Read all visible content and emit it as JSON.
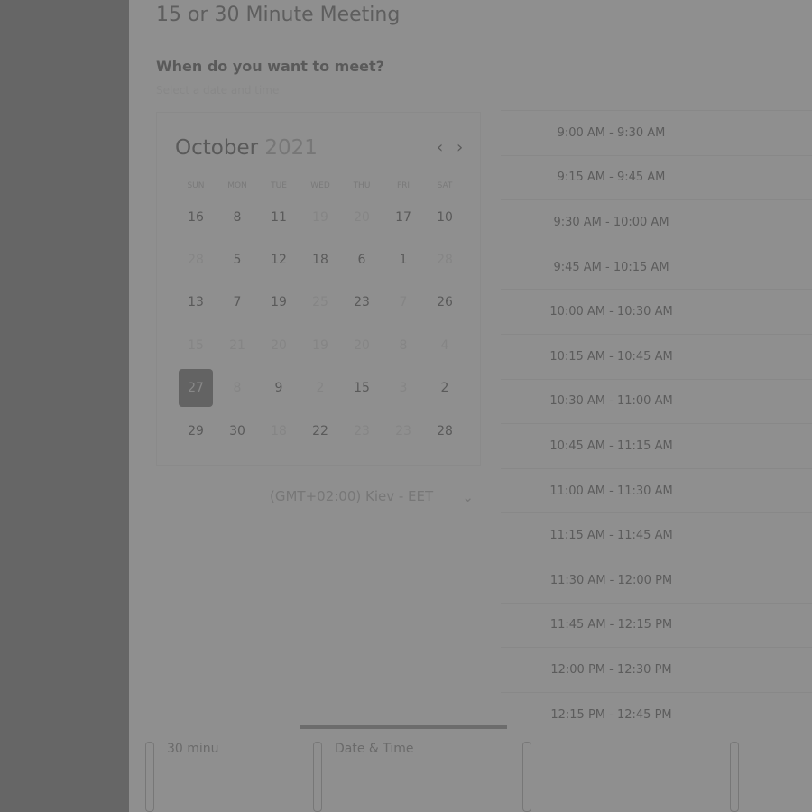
{
  "title": "15 or 30 Minute Meeting",
  "question": "When do you want to meet?",
  "subtitle": "Select a date and time",
  "calendar": {
    "month": "October",
    "year": "2021",
    "prev": "‹",
    "next": "›",
    "dows": [
      "SUN",
      "MON",
      "TUE",
      "WED",
      "THU",
      "FRI",
      "SAT"
    ],
    "days": [
      {
        "t": "16",
        "a": true
      },
      {
        "t": "8",
        "a": true
      },
      {
        "t": "11",
        "a": true
      },
      {
        "t": "19",
        "a": false
      },
      {
        "t": "20",
        "a": false
      },
      {
        "t": "17",
        "a": true
      },
      {
        "t": "10",
        "a": true
      },
      {
        "t": "28",
        "a": false
      },
      {
        "t": "5",
        "a": true
      },
      {
        "t": "12",
        "a": true
      },
      {
        "t": "18",
        "a": true
      },
      {
        "t": "6",
        "a": true
      },
      {
        "t": "1",
        "a": true
      },
      {
        "t": "28",
        "a": false
      },
      {
        "t": "13",
        "a": true
      },
      {
        "t": "7",
        "a": true
      },
      {
        "t": "19",
        "a": true
      },
      {
        "t": "25",
        "a": false
      },
      {
        "t": "23",
        "a": true
      },
      {
        "t": "7",
        "a": false
      },
      {
        "t": "26",
        "a": true
      },
      {
        "t": "15",
        "a": false
      },
      {
        "t": "21",
        "a": false
      },
      {
        "t": "20",
        "a": false
      },
      {
        "t": "19",
        "a": false
      },
      {
        "t": "20",
        "a": false
      },
      {
        "t": "8",
        "a": false
      },
      {
        "t": "4",
        "a": false
      },
      {
        "t": "27",
        "a": true,
        "sel": true
      },
      {
        "t": "8",
        "a": false
      },
      {
        "t": "9",
        "a": true
      },
      {
        "t": "2",
        "a": false
      },
      {
        "t": "15",
        "a": true
      },
      {
        "t": "3",
        "a": false
      },
      {
        "t": "2",
        "a": true
      },
      {
        "t": "29",
        "a": true
      },
      {
        "t": "30",
        "a": true
      },
      {
        "t": "18",
        "a": false
      },
      {
        "t": "22",
        "a": true
      },
      {
        "t": "23",
        "a": false
      },
      {
        "t": "23",
        "a": false
      },
      {
        "t": "28",
        "a": true
      }
    ]
  },
  "timezone": {
    "value": "(GMT+02:00) Kiev - EET",
    "chevron": "⌄"
  },
  "slots": [
    "9:00 AM - 9:30 AM",
    "9:15 AM - 9:45 AM",
    "9:30 AM - 10:00 AM",
    "9:45 AM - 10:15 AM",
    "10:00 AM - 10:30 AM",
    "10:15 AM - 10:45 AM",
    "10:30 AM - 11:00 AM",
    "10:45 AM - 11:15 AM",
    "11:00 AM - 11:30 AM",
    "11:15 AM - 11:45 AM",
    "11:30 AM - 12:00 PM",
    "11:45 AM - 12:15 PM",
    "12:00 PM - 12:30 PM",
    "12:15 PM - 12:45 PM"
  ],
  "steps": [
    {
      "label": "30 minu"
    },
    {
      "label": "Date & Time"
    }
  ]
}
